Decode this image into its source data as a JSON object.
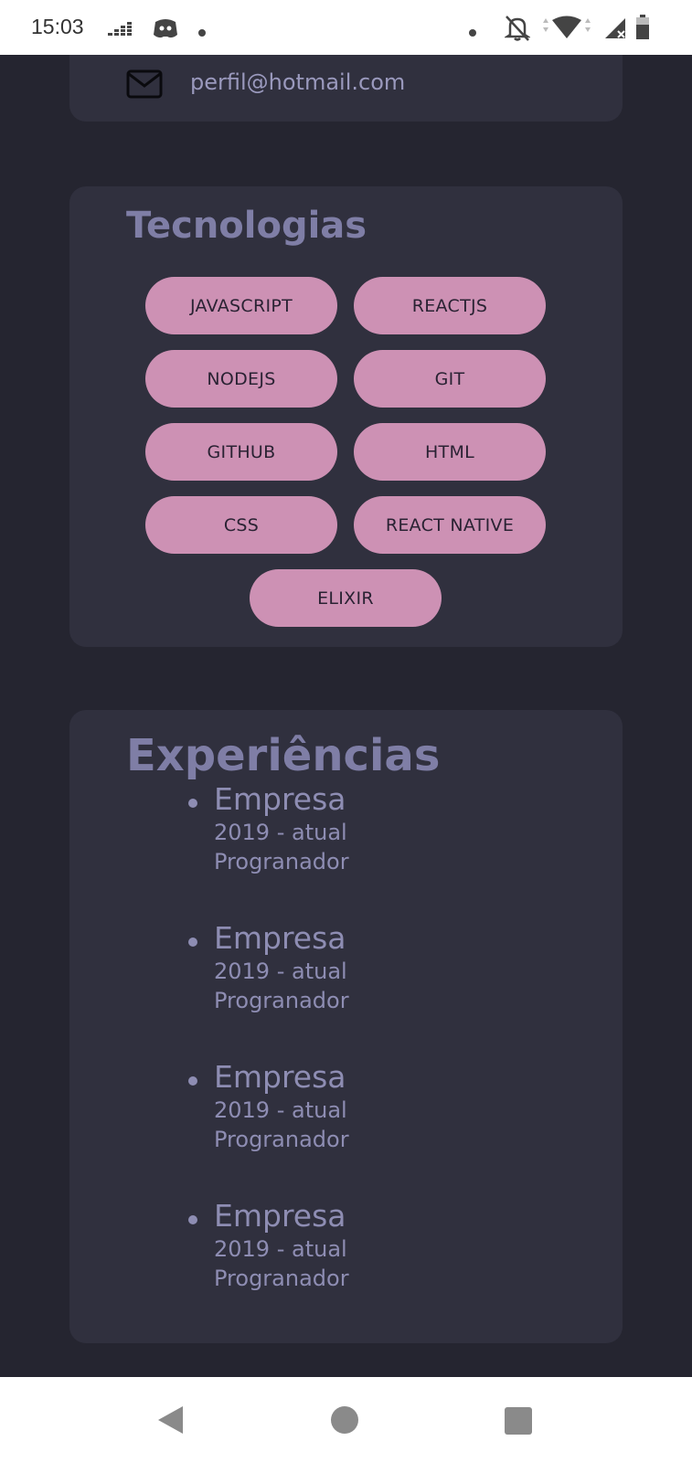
{
  "status_bar": {
    "time": "15:03",
    "icons": [
      "deezer-icon",
      "discord-icon",
      "notification-dot-icon",
      "notification-dot-icon",
      "bell-off-icon",
      "wifi-icon",
      "signal-icon",
      "battery-icon"
    ]
  },
  "contact": {
    "email": "perfil@hotmail.com",
    "icon": "mail-icon"
  },
  "technologies": {
    "title": "Tecnologias",
    "items": [
      "JAVASCRIPT",
      "REACTJS",
      "NODEJS",
      "GIT",
      "GITHUB",
      "HTML",
      "CSS",
      "REACT NATIVE",
      "ELIXIR"
    ]
  },
  "experiences": {
    "title": "Experiências",
    "items": [
      {
        "company": "Empresa",
        "period": "2019 - atual",
        "role": "Progranador"
      },
      {
        "company": "Empresa",
        "period": "2019 - atual",
        "role": "Progranador"
      },
      {
        "company": "Empresa",
        "period": "2019 - atual",
        "role": "Progranador"
      },
      {
        "company": "Empresa",
        "period": "2019 - atual",
        "role": "Progranador"
      }
    ]
  },
  "nav_bar": {
    "buttons": [
      "back-icon",
      "home-icon",
      "recents-icon"
    ]
  },
  "colors": {
    "background": "#252530",
    "card": "#30303e",
    "title": "#7f7ea6",
    "chip": "#cd91b4",
    "text": "#8e8db3"
  }
}
